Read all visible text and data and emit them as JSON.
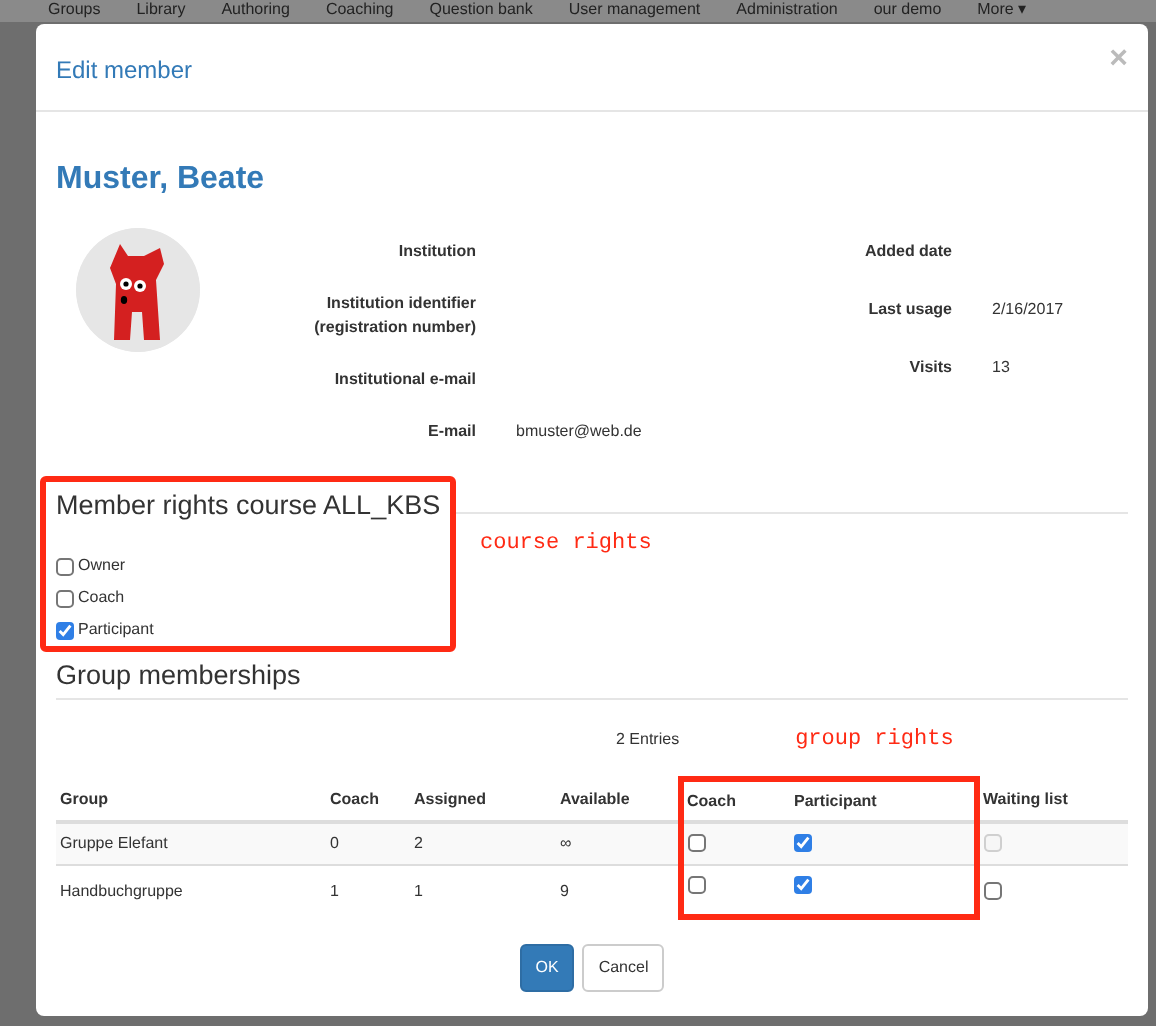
{
  "nav": [
    "Groups",
    "Library",
    "Authoring",
    "Coaching",
    "Question bank",
    "User management",
    "Administration",
    "our demo",
    "More ▾"
  ],
  "modal": {
    "title": "Edit member",
    "close": "×",
    "name": "Muster, Beate",
    "fields": [
      {
        "label": "Institution"
      },
      {
        "label": "Institution identifier (registration number)"
      },
      {
        "label": "Institutional e-mail"
      },
      {
        "label": "E-mail",
        "value": "bmuster@web.de"
      }
    ],
    "stats": [
      {
        "label": "Added date"
      },
      {
        "label": "Last usage",
        "value": "2/16/2017"
      },
      {
        "label": "Visits",
        "value": "13"
      }
    ],
    "course_rights": {
      "title": "Member rights course ALL_KBS",
      "highlighted": true,
      "annotation": "course rights",
      "options": [
        {
          "label": "Owner",
          "checked": false
        },
        {
          "label": "Coach",
          "checked": false
        },
        {
          "label": "Participant",
          "checked": true
        }
      ]
    },
    "group_memberships": {
      "title": "Group memberships",
      "entries": "2 Entries",
      "annotation": "group rights",
      "highlighted": true,
      "columns": [
        "Group",
        "Coach",
        "Assigned",
        "Available",
        "Coach",
        "Participant",
        "Waiting list"
      ],
      "rows": [
        {
          "group": "Gruppe Elefant",
          "coach": "0",
          "assigned": "2",
          "available": "∞",
          "coach_right": {
            "checked": false,
            "disabled": false
          },
          "participant_right": {
            "checked": true,
            "disabled": false
          },
          "waiting_list": {
            "checked": false,
            "disabled": true
          }
        },
        {
          "group": "Handbuchgruppe",
          "coach": "1",
          "assigned": "1",
          "available": "9",
          "coach_right": {
            "checked": false,
            "disabled": false
          },
          "participant_right": {
            "checked": true,
            "disabled": false
          },
          "waiting_list": {
            "checked": false,
            "disabled": false
          }
        }
      ]
    },
    "buttons": [
      {
        "label": "OK",
        "kind": "primary"
      },
      {
        "label": "Cancel",
        "kind": "secondary"
      }
    ]
  }
}
